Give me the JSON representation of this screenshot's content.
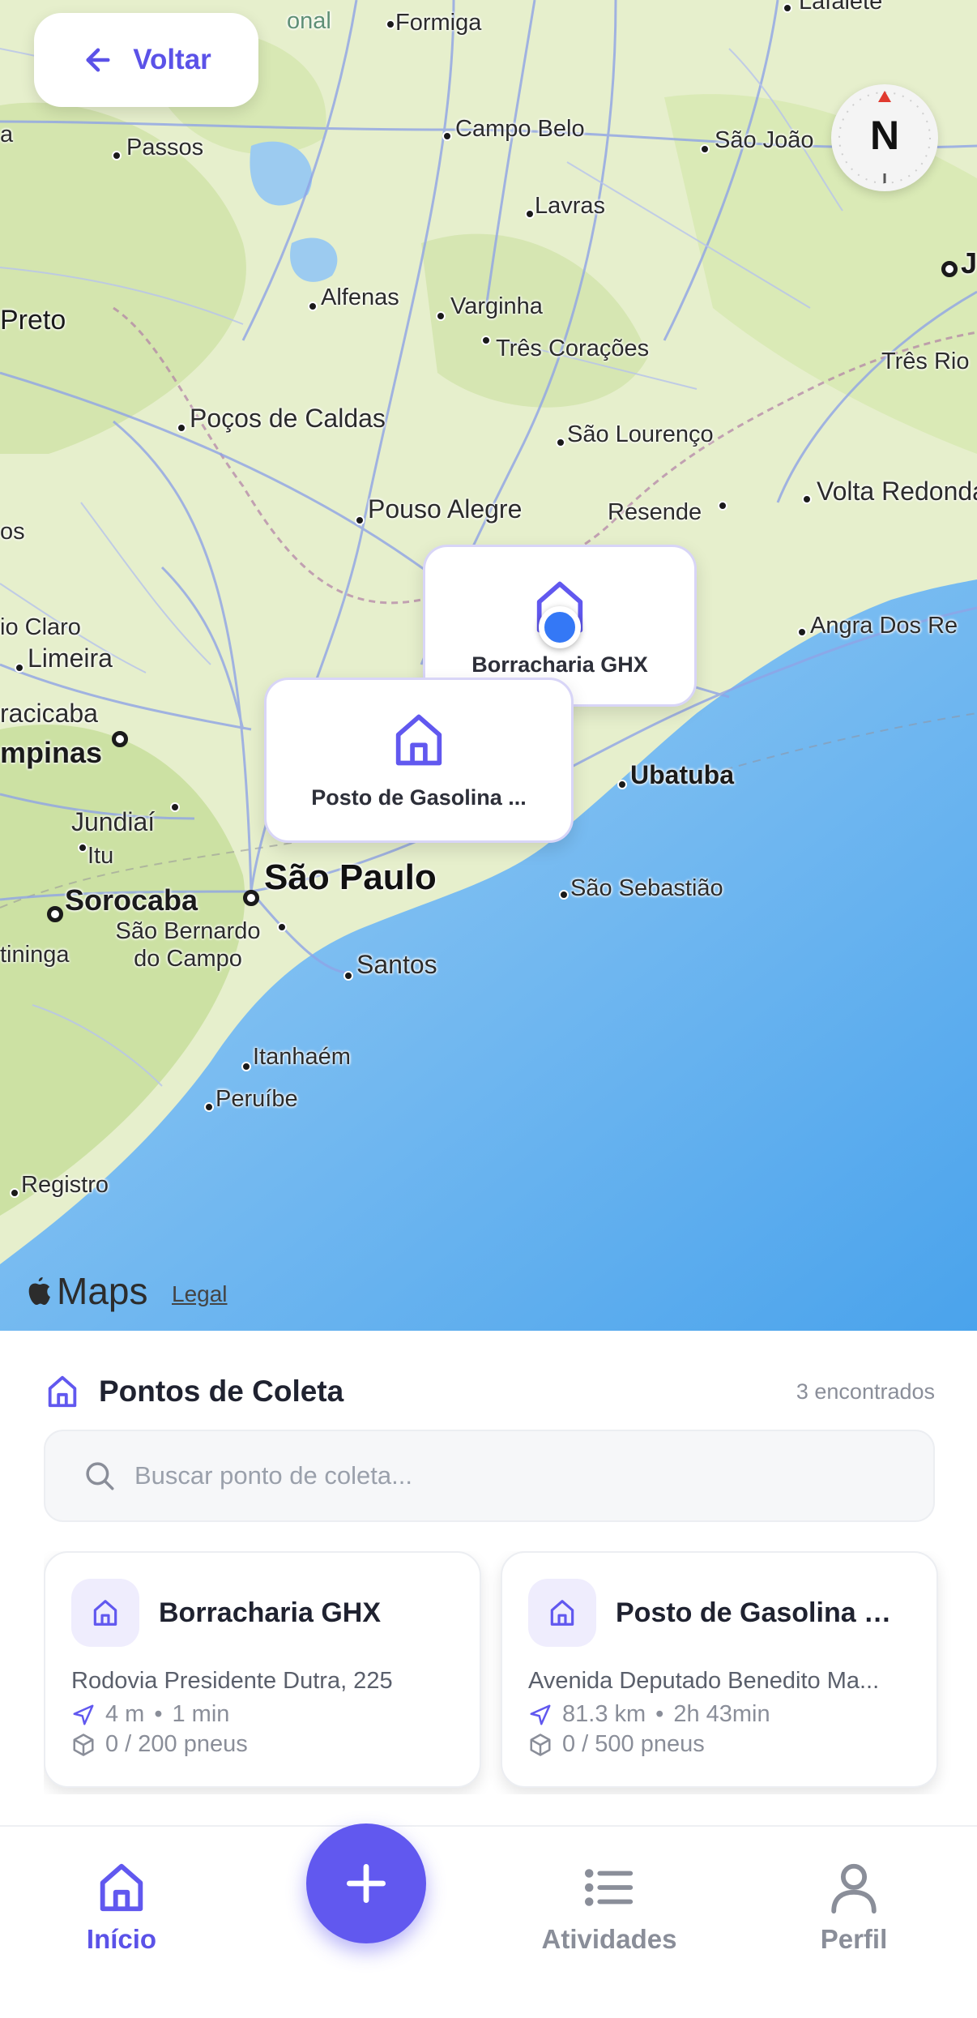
{
  "map": {
    "back_label": "Voltar",
    "compass_label": "N",
    "attribution": "Maps",
    "legal_label": "Legal",
    "cities": [
      {
        "name": "Formiga"
      },
      {
        "name": "Lafaiete"
      },
      {
        "name": "Passos"
      },
      {
        "name": "Campo Belo"
      },
      {
        "name": "São João"
      },
      {
        "name": "Lavras"
      },
      {
        "name": "Preto"
      },
      {
        "name": "Alfenas"
      },
      {
        "name": "Varginha"
      },
      {
        "name": "Três Corações"
      },
      {
        "name": "Três Rio"
      },
      {
        "name": "Poços de Caldas"
      },
      {
        "name": "São Lourenço"
      },
      {
        "name": "Pouso Alegre"
      },
      {
        "name": "Resende"
      },
      {
        "name": "Volta Redonda"
      },
      {
        "name": "io Claro"
      },
      {
        "name": "Limeira"
      },
      {
        "name": "Angra Dos Re"
      },
      {
        "name": "racicaba"
      },
      {
        "name": "mpinas"
      },
      {
        "name": "Ubatuba"
      },
      {
        "name": "Jundiaí"
      },
      {
        "name": "Itu"
      },
      {
        "name": "Sorocaba"
      },
      {
        "name": "São Paulo"
      },
      {
        "name": "São Sebastião"
      },
      {
        "name": "São Bernardo do Campo"
      },
      {
        "name": "tininga"
      },
      {
        "name": "Santos"
      },
      {
        "name": "Itanhaém"
      },
      {
        "name": "Peruíbe"
      },
      {
        "name": "Registro"
      },
      {
        "name": "a"
      },
      {
        "name": "os"
      },
      {
        "name": "J"
      },
      {
        "name": "onal"
      }
    ],
    "pins": [
      {
        "label": "Borracharia GHX"
      },
      {
        "label": "Posto de Gasolina ..."
      }
    ]
  },
  "sheet": {
    "title": "Pontos de Coleta",
    "count": "3 encontrados",
    "search_placeholder": "Buscar ponto de coleta...",
    "cards": [
      {
        "name": "Borracharia GHX",
        "address": "Rodovia Presidente Dutra, 225",
        "distance": "4 m",
        "time": "1 min",
        "capacity": "0 / 200 pneus"
      },
      {
        "name": "Posto de Gasolina Br...",
        "address": "Avenida Deputado Benedito Ma...",
        "distance": "81.3 km",
        "time": "2h 43min",
        "capacity": "0 / 500 pneus"
      }
    ]
  },
  "tabbar": {
    "home": "Início",
    "activities": "Atividades",
    "profile": "Perfil"
  },
  "colors": {
    "accent": "#6158ef",
    "user_location": "#3478f6",
    "ocean": "#6fb6ef",
    "land": "#e8f0cf"
  }
}
